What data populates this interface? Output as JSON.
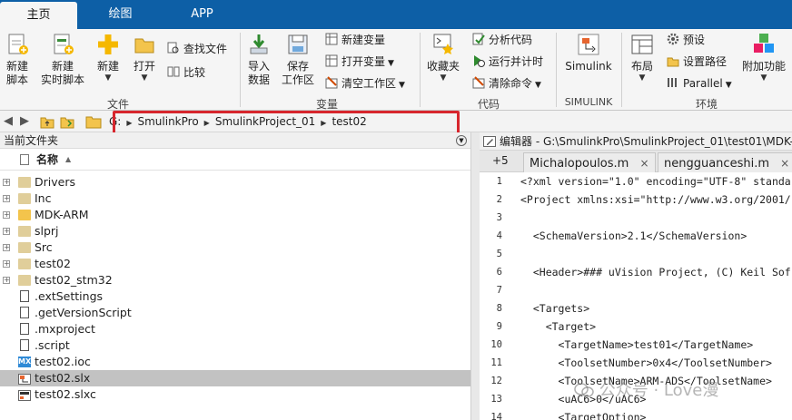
{
  "tabs": [
    "主页",
    "绘图",
    "APP"
  ],
  "ribbon": {
    "file": {
      "new_script": [
        "新建",
        "脚本"
      ],
      "new_live_script": [
        "新建",
        "实时脚本"
      ],
      "new": "新建",
      "open": "打开",
      "find_files": "查找文件",
      "compare": "比较",
      "group_label": "文件"
    },
    "variable": {
      "import_data": [
        "导入",
        "数据"
      ],
      "save_workspace": [
        "保存",
        "工作区"
      ],
      "new_variable": "新建变量",
      "open_variable": "打开变量",
      "clear_workspace": "清空工作区",
      "group_label": "变量"
    },
    "code": {
      "favorites": "收藏夹",
      "analyze_code": "分析代码",
      "run_and_time": "运行并计时",
      "clear_commands": "清除命令",
      "group_label": "代码"
    },
    "simulink": {
      "button": "Simulink",
      "group_label": "SIMULINK"
    },
    "environment": {
      "layout": "布局",
      "preferences": "预设",
      "set_path": "设置路径",
      "parallel": "Parallel",
      "addons": "附加功能",
      "group_label": "环境"
    }
  },
  "address": {
    "segments": [
      "G:",
      "SmulinkPro",
      "SmulinkProject_01",
      "test02"
    ]
  },
  "current_folder": {
    "title": "当前文件夹",
    "column_name": "名称",
    "items": [
      {
        "name": "Drivers",
        "type": "folder-gray",
        "expandable": true
      },
      {
        "name": "Inc",
        "type": "folder-gray",
        "expandable": true
      },
      {
        "name": "MDK-ARM",
        "type": "folder",
        "expandable": true
      },
      {
        "name": "slprj",
        "type": "folder-gray",
        "expandable": true
      },
      {
        "name": "Src",
        "type": "folder-gray",
        "expandable": true
      },
      {
        "name": "test02",
        "type": "folder-gray",
        "expandable": true
      },
      {
        "name": "test02_stm32",
        "type": "folder-gray",
        "expandable": true
      },
      {
        "name": ".extSettings",
        "type": "file",
        "expandable": false
      },
      {
        "name": ".getVersionScript",
        "type": "file",
        "expandable": false
      },
      {
        "name": ".mxproject",
        "type": "file",
        "expandable": false
      },
      {
        "name": ".script",
        "type": "file",
        "expandable": false
      },
      {
        "name": "test02.ioc",
        "type": "mx",
        "expandable": false
      },
      {
        "name": "test02.slx",
        "type": "slx",
        "expandable": false,
        "selected": true
      },
      {
        "name": "test02.slxc",
        "type": "slxc",
        "expandable": false
      }
    ]
  },
  "editor": {
    "title": "编辑器 - G:\\SmulinkPro\\SmulinkProject_01\\test01\\MDK-",
    "tab_counter": "+5",
    "tabs": [
      "Michalopoulos.m",
      "nengguanceshi.m"
    ],
    "lines": [
      {
        "n": "1",
        "text": "<?xml version=\"1.0\" encoding=\"UTF-8\" standa"
      },
      {
        "n": "2",
        "text": "<Project xmlns:xsi=\"http://www.w3.org/2001/"
      },
      {
        "n": "3",
        "text": ""
      },
      {
        "n": "4",
        "text": "  <SchemaVersion>2.1</SchemaVersion>"
      },
      {
        "n": "5",
        "text": ""
      },
      {
        "n": "6",
        "text": "  <Header>### uVision Project, (C) Keil Sof"
      },
      {
        "n": "7",
        "text": ""
      },
      {
        "n": "8",
        "text": "  <Targets>"
      },
      {
        "n": "9",
        "text": "    <Target>"
      },
      {
        "n": "10",
        "text": "      <TargetName>test01</TargetName>"
      },
      {
        "n": "11",
        "text": "      <ToolsetNumber>0x4</ToolsetNumber>"
      },
      {
        "n": "12",
        "text": "      <ToolsetName>ARM-ADS</ToolsetName>"
      },
      {
        "n": "13",
        "text": "      <uAC6>0</uAC6>"
      },
      {
        "n": "14",
        "text": "      <TargetOption>"
      }
    ]
  },
  "watermark": "公众号 · Love漫"
}
